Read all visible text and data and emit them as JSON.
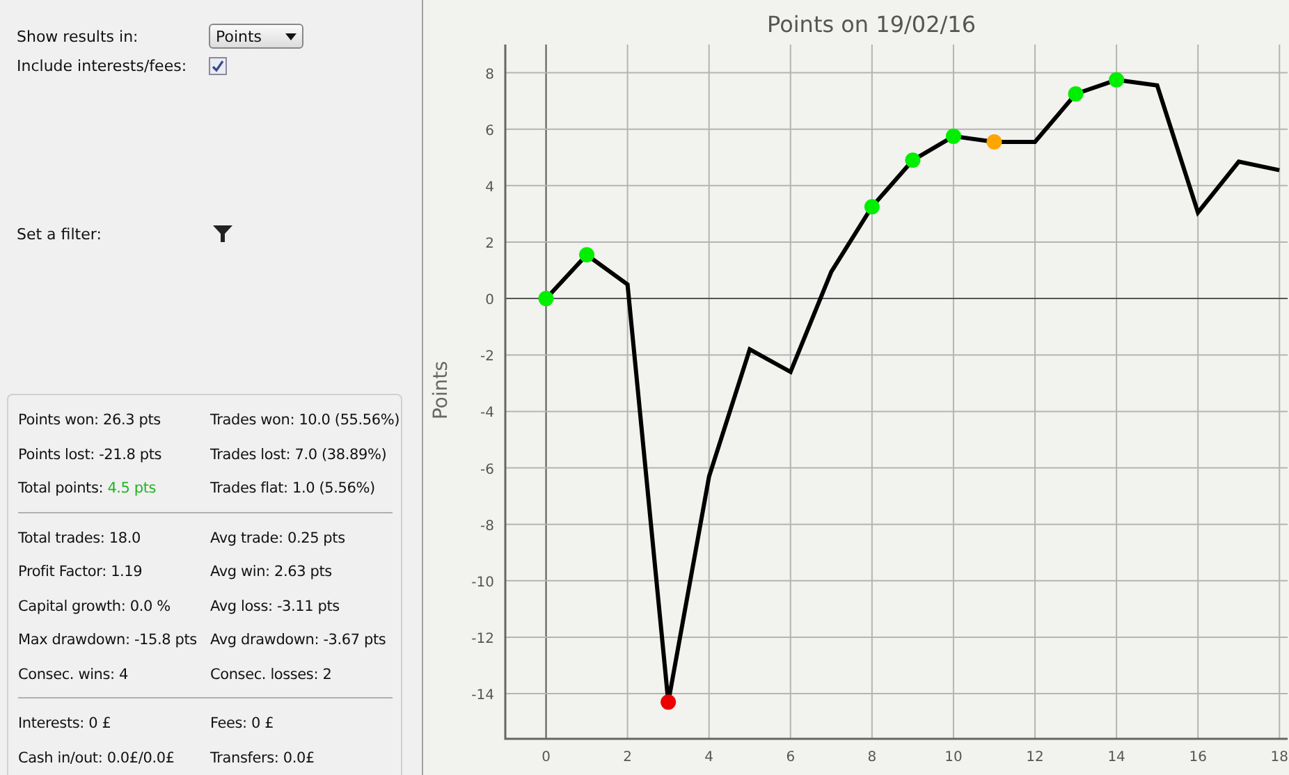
{
  "settings": {
    "results_label": "Show results in:",
    "results_value": "Points",
    "interests_label": "Include interests/fees:",
    "interests_checked": true,
    "filter_label": "Set a filter:"
  },
  "stats": [
    [
      [
        {
          "label": "Points won:",
          "value": "26.3 pts",
          "highlight": false
        },
        {
          "label": "Trades won:",
          "value": "10.0 (55.56%)",
          "highlight": false
        }
      ],
      [
        {
          "label": "Points lost:",
          "value": "-21.8 pts",
          "highlight": false
        },
        {
          "label": "Trades lost:",
          "value": "7.0 (38.89%)",
          "highlight": false
        }
      ],
      [
        {
          "label": "Total points:",
          "value": "4.5 pts",
          "highlight": true
        },
        {
          "label": "Trades flat:",
          "value": "1.0 (5.56%)",
          "highlight": false
        }
      ]
    ],
    [
      [
        {
          "label": "Total trades:",
          "value": "18.0",
          "highlight": false
        },
        {
          "label": "Avg trade:",
          "value": "0.25 pts",
          "highlight": false
        }
      ],
      [
        {
          "label": "Profit Factor:",
          "value": "1.19",
          "highlight": false
        },
        {
          "label": "Avg win:",
          "value": "2.63 pts",
          "highlight": false
        }
      ],
      [
        {
          "label": "Capital growth:",
          "value": "0.0 %",
          "highlight": false
        },
        {
          "label": "Avg loss:",
          "value": "-3.11 pts",
          "highlight": false
        }
      ],
      [
        {
          "label": "Max drawdown:",
          "value": "-15.8 pts",
          "highlight": false
        },
        {
          "label": "Avg drawdown:",
          "value": "-3.67 pts",
          "highlight": false
        }
      ],
      [
        {
          "label": "Consec. wins:",
          "value": "4",
          "highlight": false
        },
        {
          "label": "Consec. losses:",
          "value": "2",
          "highlight": false
        }
      ]
    ],
    [
      [
        {
          "label": "Interests:",
          "value": "0 £",
          "highlight": false
        },
        {
          "label": "Fees:",
          "value": "0 £",
          "highlight": false
        }
      ],
      [
        {
          "label": "Cash in/out:",
          "value": "0.0£/0.0£",
          "highlight": false
        },
        {
          "label": "Transfers:",
          "value": "0.0£",
          "highlight": false
        }
      ]
    ]
  ],
  "chart": {
    "chart_data": {
      "type": "line",
      "title": "Points on 19/02/16",
      "ylabel": "Points",
      "grid": true,
      "x": [
        0,
        1,
        2,
        3,
        4,
        5,
        6,
        7,
        8,
        9,
        10,
        11,
        12,
        13,
        14,
        15,
        16,
        17,
        18
      ],
      "values": [
        0,
        1.55,
        0.5,
        -14.3,
        -6.3,
        -1.8,
        -2.6,
        0.95,
        3.25,
        4.9,
        5.75,
        5.55,
        5.55,
        7.25,
        7.75,
        7.55,
        3.05,
        4.85,
        4.55
      ],
      "xlim": [
        -1,
        18.2
      ],
      "ylim": [
        -15.6,
        9
      ],
      "xticks": [
        0,
        2,
        4,
        6,
        8,
        10,
        12,
        14,
        16,
        18
      ],
      "yticks": [
        -14,
        -12,
        -10,
        -8,
        -6,
        -4,
        -2,
        0,
        2,
        4,
        6,
        8
      ]
    },
    "points": [
      {
        "kind": "win"
      },
      {
        "kind": "win"
      },
      {
        "kind": "plain"
      },
      {
        "kind": "loss"
      },
      {
        "kind": "plain"
      },
      {
        "kind": "plain"
      },
      {
        "kind": "plain"
      },
      {
        "kind": "plain"
      },
      {
        "kind": "win"
      },
      {
        "kind": "win"
      },
      {
        "kind": "win"
      },
      {
        "kind": "flat"
      },
      {
        "kind": "plain"
      },
      {
        "kind": "win"
      },
      {
        "kind": "win"
      },
      {
        "kind": "plain"
      },
      {
        "kind": "plain"
      },
      {
        "kind": "plain"
      },
      {
        "kind": "plain"
      }
    ]
  }
}
